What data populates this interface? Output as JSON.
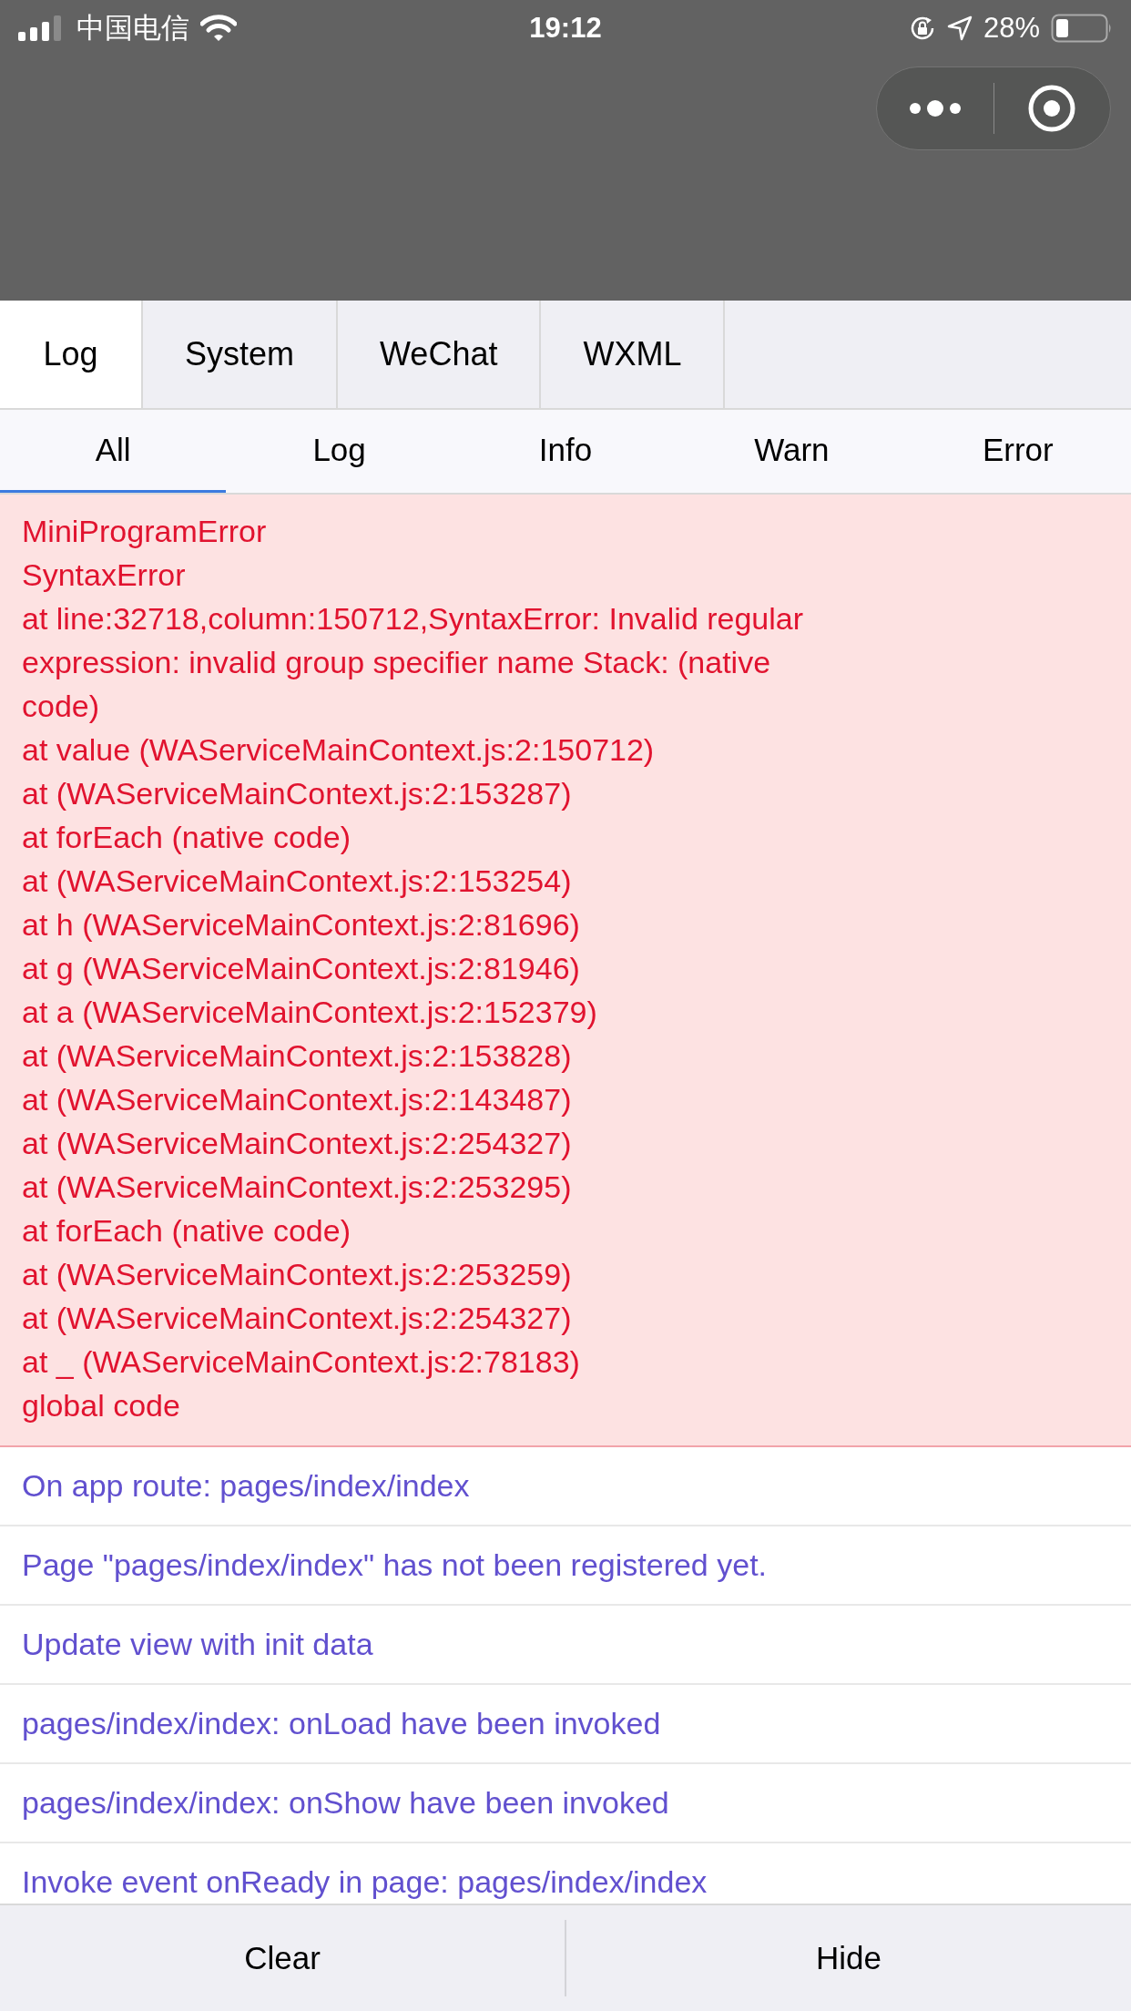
{
  "status_bar": {
    "carrier": "中国电信",
    "time": "19:12",
    "battery": "28%"
  },
  "tabs": [
    {
      "label": "Log",
      "selected": true
    },
    {
      "label": "System",
      "selected": false
    },
    {
      "label": "WeChat",
      "selected": false
    },
    {
      "label": "WXML",
      "selected": false
    }
  ],
  "filters": [
    {
      "label": "All",
      "selected": true
    },
    {
      "label": "Log",
      "selected": false
    },
    {
      "label": "Info",
      "selected": false
    },
    {
      "label": "Warn",
      "selected": false
    },
    {
      "label": "Error",
      "selected": false
    }
  ],
  "entries": [
    {
      "kind": "error",
      "lines": [
        "MiniProgramError",
        "SyntaxError",
        "at line:32718,column:150712,SyntaxError: Invalid regular",
        "expression: invalid group specifier name Stack: (native",
        "code)",
        "at value (WAServiceMainContext.js:2:150712)",
        "at (WAServiceMainContext.js:2:153287)",
        "at forEach (native code)",
        "at (WAServiceMainContext.js:2:153254)",
        "at h (WAServiceMainContext.js:2:81696)",
        "at g (WAServiceMainContext.js:2:81946)",
        "at a (WAServiceMainContext.js:2:152379)",
        "at (WAServiceMainContext.js:2:153828)",
        "at (WAServiceMainContext.js:2:143487)",
        "at (WAServiceMainContext.js:2:254327)",
        "at (WAServiceMainContext.js:2:253295)",
        "at forEach (native code)",
        "at (WAServiceMainContext.js:2:253259)",
        "at (WAServiceMainContext.js:2:254327)",
        "at _ (WAServiceMainContext.js:2:78183)",
        "global code"
      ]
    },
    {
      "kind": "log",
      "text": "On app route: pages/index/index"
    },
    {
      "kind": "log",
      "text": "Page \"pages/index/index\" has not been registered yet."
    },
    {
      "kind": "log",
      "text": "Update view with init data"
    },
    {
      "kind": "log",
      "text": "pages/index/index: onLoad have been invoked"
    },
    {
      "kind": "log",
      "text": "pages/index/index: onShow have been invoked"
    },
    {
      "kind": "log",
      "text": "Invoke event onReady in page: pages/index/index"
    }
  ],
  "actions": [
    "Clear",
    "Hide"
  ]
}
